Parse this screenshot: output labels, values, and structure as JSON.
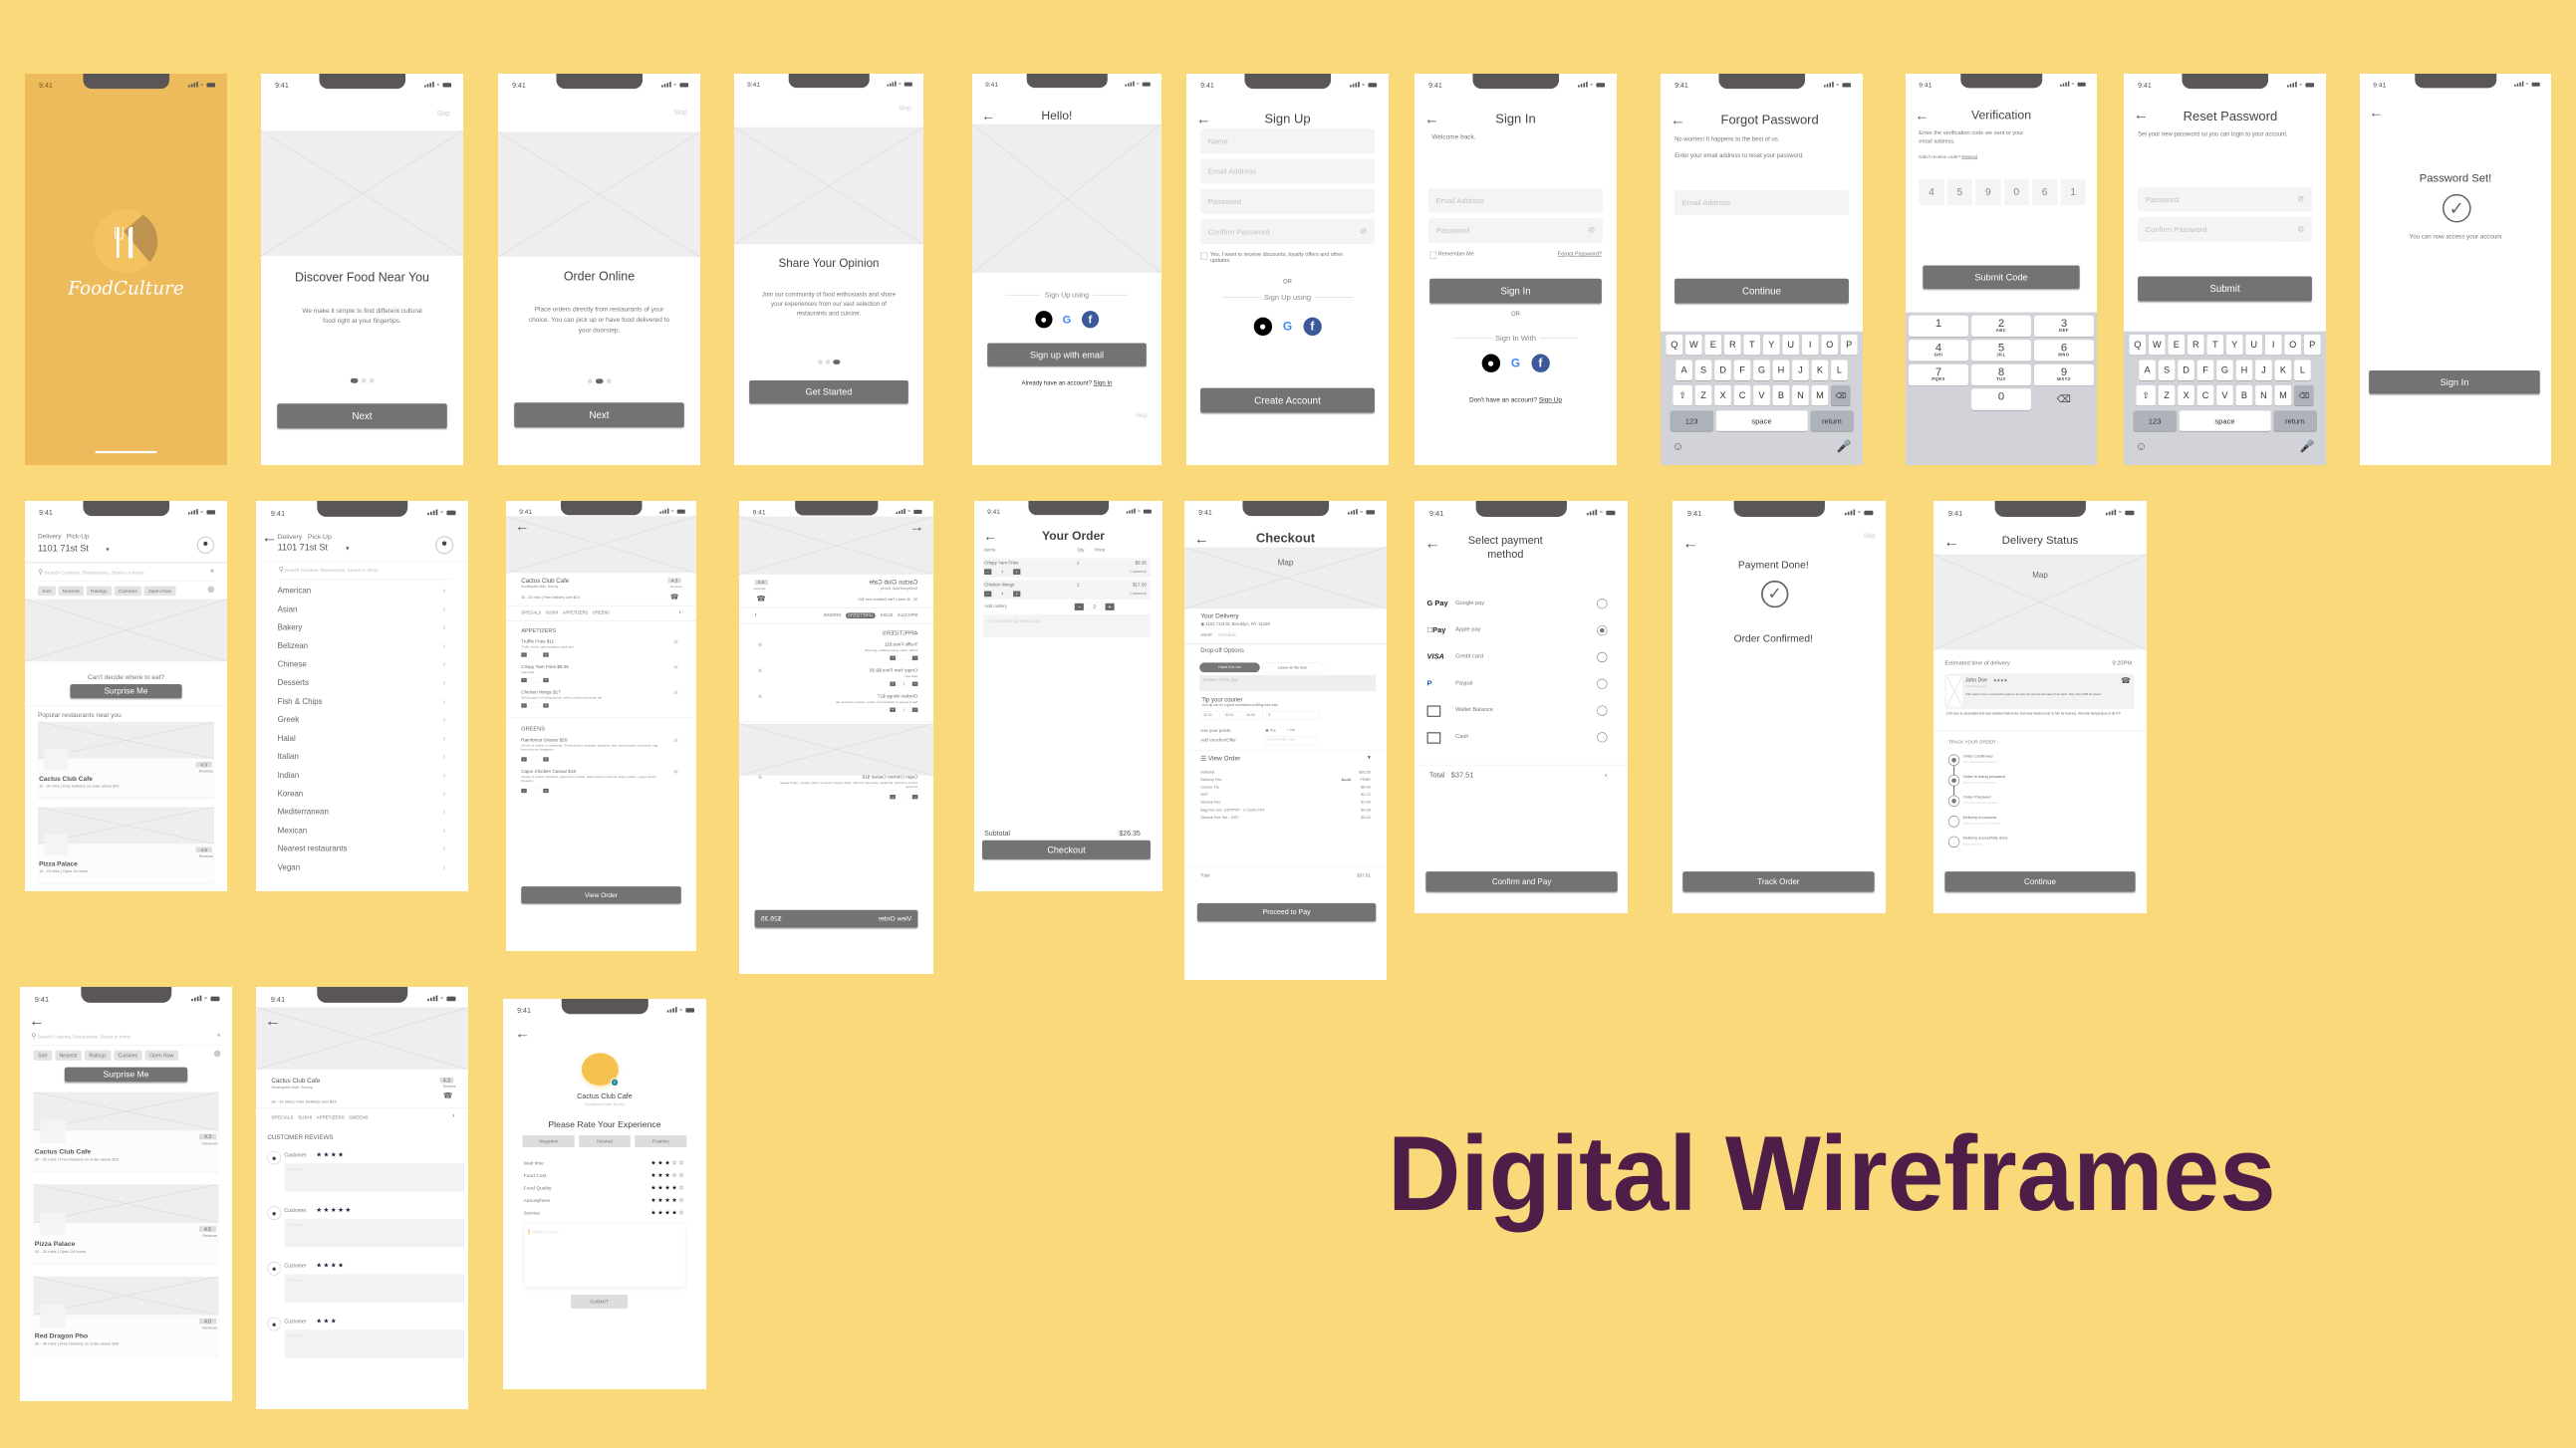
{
  "page": {
    "title": "Digital Wireframes",
    "colors": {
      "background": "#F9D97A",
      "title": "#4E1E48",
      "button": "#737373",
      "splash": "#EDBB5B"
    }
  },
  "status": {
    "time": "9:41"
  },
  "splash": {
    "brand": "FoodCulture"
  },
  "onboarding": [
    {
      "skip": "Skip",
      "title": "Discover Food Near You",
      "text": "We make it simple to find different cultural food right at your fingertips.",
      "button": "Next",
      "active_dot": 1
    },
    {
      "skip": "Skip",
      "title": "Order Online",
      "text": "Place orders directly from restaurants of your choice. You can pick up or have food delivered to your doorstep.",
      "button": "Next",
      "active_dot": 2
    },
    {
      "skip": "Skip",
      "title": "Share Your Opinion",
      "text": "Join our community of food enthusiasts and share your experiences from our vast selection of restaurants and cuisine.",
      "button": "Get Started",
      "active_dot": 3
    }
  ],
  "hello": {
    "title": "Hello!",
    "sign_up_using": "Sign Up using",
    "button": "Sign up with email",
    "have_account": "Already have an account?",
    "sign_in": "Sign In",
    "skip": "Skip"
  },
  "signup": {
    "title": "Sign Up",
    "fields": [
      "Name",
      "Email Address",
      "Password",
      "Confirm Password"
    ],
    "checkbox": "Yes, I want to receive discounts, loyalty offers and other updates.",
    "or": "OR",
    "sign_up_using": "Sign Up using",
    "button": "Create Account"
  },
  "signin": {
    "title": "Sign In",
    "welcome": "Welcome back.",
    "fields": [
      "Email Address",
      "Password"
    ],
    "remember": "Remember Me",
    "forgot": "Forgot Password?",
    "button": "Sign In",
    "or": "OR",
    "sign_in_with": "Sign In With",
    "no_account": "Don't have an account?",
    "sign_up": "Sign Up"
  },
  "forgot": {
    "title": "Forgot Password",
    "line1": "No worries! It happens to the best of us.",
    "line2": "Enter your email address to reset your password.",
    "field": "Email Address",
    "button": "Continue"
  },
  "keyboard": {
    "rows": [
      [
        "Q",
        "W",
        "E",
        "R",
        "T",
        "Y",
        "U",
        "I",
        "O",
        "P"
      ],
      [
        "A",
        "S",
        "D",
        "F",
        "G",
        "H",
        "J",
        "K",
        "L"
      ],
      [
        "Z",
        "X",
        "C",
        "V",
        "B",
        "N",
        "M"
      ]
    ],
    "numbers": "123",
    "space": "space",
    "return": "return"
  },
  "numpad": [
    {
      "n": "1",
      "l": ""
    },
    {
      "n": "2",
      "l": "ABC"
    },
    {
      "n": "3",
      "l": "DEF"
    },
    {
      "n": "4",
      "l": "GHI"
    },
    {
      "n": "5",
      "l": "JKL"
    },
    {
      "n": "6",
      "l": "MNO"
    },
    {
      "n": "7",
      "l": "PQRS"
    },
    {
      "n": "8",
      "l": "TUV"
    },
    {
      "n": "9",
      "l": "WXYZ"
    },
    {
      "n": "0",
      "l": ""
    }
  ],
  "verification": {
    "title": "Verification",
    "text": "Enter the verification code we sent to your email address.",
    "didnt": "Didn't receive code?",
    "resend": "Resend",
    "code": [
      "4",
      "5",
      "9",
      "0",
      "6",
      "1"
    ],
    "button": "Submit Code"
  },
  "reset": {
    "title": "Reset Password",
    "text": "Set your new password so you can login to your account.",
    "fields": [
      "Password",
      "Confirm Password"
    ],
    "button": "Submit"
  },
  "pwset": {
    "title": "Password Set!",
    "text": "You can now access your account",
    "button": "Sign In"
  },
  "home": {
    "tabs": [
      "Delivery",
      "Pick-Up"
    ],
    "address": "1101 71st St",
    "search": "Search Cuisines, Restaurants, Stores or Items",
    "filters": [
      "Sort",
      "Nearest",
      "Ratings",
      "Cuisines",
      "Open Now"
    ],
    "prompt": "Can't decide where to eat?",
    "surprise": "Surprise Me",
    "popular": "Popular restaurants near you"
  },
  "restaurants": [
    {
      "name": "Cactus Club Cafe",
      "info": "30 - 32 mins | Free Delivery on order above $15",
      "rating": "4.3"
    },
    {
      "name": "Pizza Palace",
      "info": "15 - 20 mins | Open 24 hours",
      "rating": "4.5"
    },
    {
      "name": "Red Dragon Pho",
      "info": "30 - 40 mins | Free Delivery on order above $30",
      "rating": "4.0"
    }
  ],
  "reviews_label": "Reviews",
  "cuisines": [
    "American",
    "Asian",
    "Bakery",
    "Belizean",
    "Chinese",
    "Desserts",
    "Fish & Chips",
    "Greek",
    "Halal",
    "Italian",
    "Indian",
    "Korean",
    "Mediterranean",
    "Mexican",
    "Nearest restaurants",
    "Vegan"
  ],
  "menu": {
    "name": "Cactus Club Cafe",
    "location": "Southpoint Mall, Surrey",
    "rating": "4.3",
    "delivery": "30 - 32 mins | Free Delivery over $15",
    "tabs": [
      "SPECIALS",
      "SUSHI",
      "APPETIZERS",
      "GREENS"
    ],
    "active_tab": "APPETIZERS",
    "sections": [
      {
        "title": "APPETIZERS",
        "items": [
          {
            "name": "Truffle Fries  $11",
            "desc": "Truffle, herbs, grana padano, garli aioli"
          },
          {
            "name": "Crispy Yam Fries  $9.35",
            "desc": "Garli aioli"
          },
          {
            "name": "Chicken Wings  $17",
            "desc": "Salt & pepper or louisiana hot, celery, creamy parmesan dip"
          }
        ]
      },
      {
        "title": "GREENS",
        "items": [
          {
            "name": "Rainforest Greens  $20",
            "desc": "Choice of protein or vegetarian. Fresh greens, avocado, tomatoes, feta, spicy pecans, cucumber, egg, lemon-thyme vinaigrette."
          },
          {
            "name": "Cajun Chicken Caesar  $18",
            "desc": "Choice of protein. Romaine, parmesan crumble, black pepper croutons, crispy capers, yogurt caesar dressing."
          }
        ]
      }
    ],
    "button": "View Order",
    "order_total": "$26.35",
    "qty": "1"
  },
  "order": {
    "title": "Your Order",
    "cols": [
      "Items",
      "Qty",
      "Price"
    ],
    "items": [
      {
        "name": "Crispy Yam Fries",
        "qty": "1",
        "price": "$9.35",
        "customize": "Customize"
      },
      {
        "name": "Chicken Wings",
        "qty": "1",
        "price": "$17.00",
        "customize": "Customize"
      }
    ],
    "cutlery": "Add cutlery",
    "cutlery_qty": "2",
    "instructions": "Any food/allergy instruction",
    "subtotal_label": "Subtotal",
    "subtotal": "$26.35",
    "button": "Checkout"
  },
  "checkout": {
    "title": "Checkout",
    "map": "Map",
    "your_delivery": "Your Delivery",
    "address": "1101 71st St, Brooklyn, NY 11228",
    "asap": "ASAP",
    "schedule": "Schedule",
    "dropoff": "Drop-off Options",
    "opt1": "Hand it to me",
    "opt2": "Leave at the door",
    "note": "Beware of the dog",
    "tip_title": "Tip your courier",
    "tip_text": "Your tip can be a great contribution fulfilling their wish",
    "tips": [
      "$2.00",
      "$3.00",
      "$4.00",
      "$"
    ],
    "points": "Use your points",
    "yes": "Yes",
    "no": "No",
    "voucher": "Add Voucher/Offer",
    "voucher_ph": "Voucher/Offer code",
    "view_order": "View Order",
    "lines": [
      {
        "label": "Subtotal",
        "old": "",
        "value": "$26.35"
      },
      {
        "label": "Delivery Fee",
        "old": "$1.49",
        "value": "FREE"
      },
      {
        "label": "Courier Tip",
        "old": "",
        "value": "$6.09"
      },
      {
        "label": "GST",
        "old": "",
        "value": "$2.70"
      },
      {
        "label": "Service Fee",
        "old": "",
        "value": "$1.99"
      },
      {
        "label": "Bag Fee Incl. GST/PST - 2 Cents PST",
        "old": "",
        "value": "$0.28"
      },
      {
        "label": "Service Fee Tax - GST",
        "old": "",
        "value": "$0.10"
      }
    ],
    "total_label": "Total",
    "total": "$37.51",
    "button": "Proceed to Pay"
  },
  "payment": {
    "title_1": "Select payment",
    "title_2": "method",
    "methods": [
      {
        "logo": "G Pay",
        "label": "Google pay",
        "selected": false
      },
      {
        "logo": "Pay",
        "label": "Apple pay",
        "selected": true
      },
      {
        "logo": "VISA",
        "label": "Credit card",
        "selected": false
      },
      {
        "logo": "P",
        "label": "Paypal",
        "selected": false
      },
      {
        "logo": "wallet-icon",
        "label": "Wallet Balance",
        "selected": false
      },
      {
        "logo": "cash-icon",
        "label": "Cash",
        "selected": false
      }
    ],
    "total_label": "Total",
    "total": "$37.51",
    "button": "Confirm and Pay"
  },
  "done": {
    "skip": "Skip",
    "title": "Payment Done!",
    "confirmed": "Order Confirmed!",
    "button": "Track Order"
  },
  "delivery_status": {
    "title": "Delivery Status",
    "map": "Map",
    "eta_label": "Estimated time of delivery",
    "eta": "9:20PM",
    "driver": "John Doe",
    "driver_stars": "★★★★",
    "driver_role": "Your delivery guy",
    "driver_bio": "John wants to be a successful engineer & repay the loan he has taken from bank. Help John fulfill his dream.",
    "safety": "John Doe is vaccinated and was sanitized before the food was handed over to him for delivery. His body temperature is 98.9°F",
    "track": "TRACK YOUR ORDER",
    "steps": [
      {
        "t": "Order Confirmed",
        "s": "Your order has been received",
        "done": true
      },
      {
        "t": "Order is being prepared",
        "s": "Your food is getting prepared",
        "done": true
      },
      {
        "t": "Order Prepared",
        "s": "Your order has been prepared",
        "done": true
      },
      {
        "t": "Delivery in process",
        "s": "Hang on, your food is on the way",
        "done": false
      },
      {
        "t": "Delivery sucessfully done",
        "s": "Enjoy your food!",
        "done": false
      }
    ],
    "button": "Continue"
  },
  "customer_reviews": {
    "title": "CUSTOMER REVIEWS",
    "customer": "Customer",
    "review_ph": "Review",
    "stars": [
      4,
      5,
      4,
      3
    ]
  },
  "rate": {
    "name": "Cactus Club Cafe",
    "location": "Southpoint Mall, Surrey",
    "title": "Please Rate Your Experience",
    "sentiments": [
      "Negative",
      "Neutral",
      "Positive"
    ],
    "criteria": [
      {
        "label": "Wait time",
        "stars": 3
      },
      {
        "label": "Food Cost",
        "stars": 3
      },
      {
        "label": "Food Quality",
        "stars": 4
      },
      {
        "label": "Atmosphere",
        "stars": 4
      },
      {
        "label": "Service",
        "stars": 4
      }
    ],
    "placeholder": "Write review",
    "button": "SUBMIT",
    "accent": "#F6C24F"
  }
}
